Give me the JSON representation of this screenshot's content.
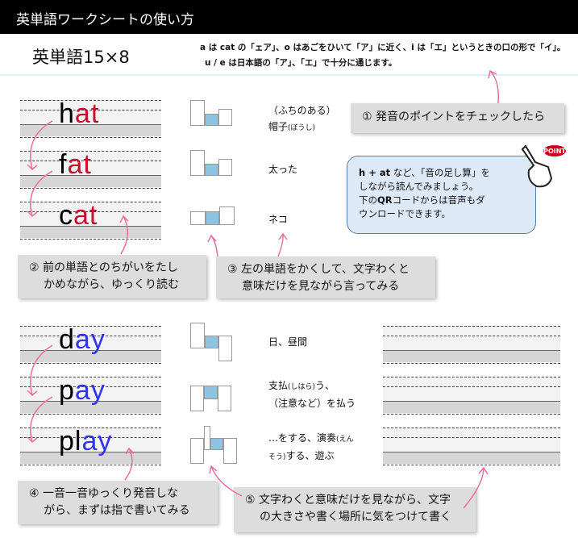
{
  "header": {
    "title": "英単語ワークシートの使い方"
  },
  "worksheet_title": "英単語15×8",
  "note": {
    "line1": "a は cat の「ェア」、o はあごをひいて「ア」に近く、i は「エ」というときの口の形で「イ」。",
    "line2": "u / e は日本語の「ア」、「エ」で十分に通じます。"
  },
  "group1": {
    "words": [
      {
        "head": "h",
        "tail": "at",
        "meaning": "（ふちのある）",
        "meaning2": "帽子",
        "ruby": "(ぼうし)"
      },
      {
        "head": "f",
        "tail": "at",
        "meaning": "太った"
      },
      {
        "head": "c",
        "tail": "at",
        "meaning": "ネコ"
      }
    ],
    "accent": "#c8102e"
  },
  "group2": {
    "words": [
      {
        "head": "d",
        "tail": "ay",
        "meaning": "日、昼間"
      },
      {
        "head": "p",
        "tail": "ay",
        "meaning": "支払",
        "ruby": "(しはら)",
        "meaning_b": "う、",
        "meaning2": "（注意など）を払う"
      },
      {
        "head": "pl",
        "tail": "ay",
        "meaning": "…をする、演奏",
        "ruby": "(えん",
        "meaning2_ruby": "そう)",
        "meaning2": "する、遊ぶ"
      }
    ],
    "accent": "#3333ee"
  },
  "callouts": {
    "c1": "①  発音のポイントをチェックしたら",
    "c2a": "②  前の単語とのちがいをたし",
    "c2b": "かめながら、ゆっくり読む",
    "c3a": "③  左の単語をかくして、文字わくと",
    "c3b": "意味だけを見ながら言ってみる",
    "c4a": "④  一音一音ゆっくり発音しな",
    "c4b": "がら、まずは指で書いてみる",
    "c5a": "⑤  文字わくと意味だけを見ながら、文字",
    "c5b": "の大きさや書く場所に気をつけて書く"
  },
  "bubble": {
    "l1a": "h + at",
    "l1b": " など、「音の足し算」を",
    "l2": "しながら読んでみましょう。",
    "l3a": "下の",
    "l3b": "QR",
    "l3c": "コードからは音声もダ",
    "l4": "ウンロードできます。"
  },
  "point_badge": "POINT",
  "arrow_color": "#e8709a"
}
